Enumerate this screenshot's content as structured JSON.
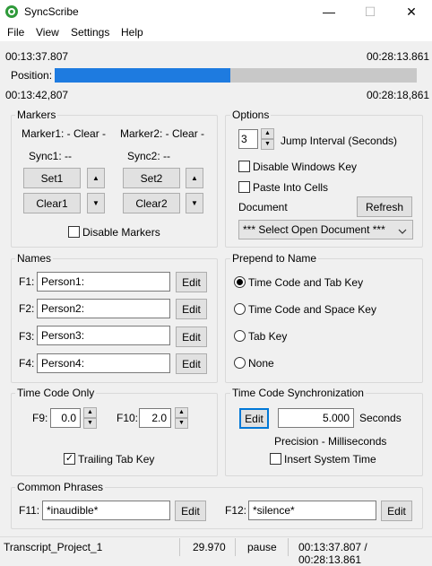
{
  "window": {
    "title": "SyncScribe",
    "minimize_glyph": "—",
    "maximize_glyph": "☐",
    "close_glyph": "✕"
  },
  "menu": [
    "File",
    "View",
    "Settings",
    "Help"
  ],
  "player": {
    "current_time_top": "00:13:37.807",
    "total_time_top": "00:28:13.861",
    "position_label": "Position:",
    "progress_fraction": 0.485,
    "current_time_bottom": "00:13:42,807",
    "total_time_bottom": "00:28:18,861"
  },
  "markers": {
    "title": "Markers",
    "marker1_label": "Marker1: - Clear -",
    "marker2_label": "Marker2: - Clear -",
    "sync1_label": "Sync1: --",
    "sync2_label": "Sync2: --",
    "set1_label": "Set1",
    "set2_label": "Set2",
    "clear1_label": "Clear1",
    "clear2_label": "Clear2",
    "disable_label": "Disable Markers",
    "disable_checked": false
  },
  "options": {
    "title": "Options",
    "jump_interval_value": "3",
    "jump_interval_label": "Jump Interval (Seconds)",
    "disable_windows_key_label": "Disable Windows Key",
    "paste_into_cells_label": "Paste Into Cells",
    "document_label": "Document",
    "refresh_label": "Refresh",
    "document_select": "*** Select Open Document ***"
  },
  "names": {
    "title": "Names",
    "edit_label": "Edit",
    "rows": [
      {
        "key": "F1:",
        "value": "Person1:"
      },
      {
        "key": "F2:",
        "value": "Person2:"
      },
      {
        "key": "F3:",
        "value": "Person3:"
      },
      {
        "key": "F4:",
        "value": "Person4:"
      }
    ]
  },
  "prepend": {
    "title": "Prepend to Name",
    "selected_index": 0,
    "options": [
      "Time Code and Tab Key",
      "Time Code and Space Key",
      "Tab Key",
      "None"
    ]
  },
  "timecode_only": {
    "title": "Time Code Only",
    "f9_label": "F9:",
    "f9_value": "0.0",
    "f10_label": "F10:",
    "f10_value": "2.0",
    "trailing_tab_label": "Trailing Tab Key",
    "trailing_tab_checked": true
  },
  "tc_sync": {
    "title": "Time Code Synchronization",
    "edit_label": "Edit",
    "value": "5.000",
    "unit": "Seconds",
    "precision_label": "Precision - Milliseconds",
    "insert_system_time_label": "Insert System Time"
  },
  "phrases": {
    "title": "Common Phrases",
    "f11_label": "F11:",
    "f11_value": "*inaudible*",
    "f12_label": "F12:",
    "f12_value": "*silence*",
    "edit_label": "Edit"
  },
  "status": {
    "project": "Transcript_Project_1",
    "fps": "29.970",
    "state": "pause",
    "timecode": "00:13:37.807 / 00:28:13.861"
  },
  "icons": {
    "app": "app-logo-icon",
    "up": "▲",
    "down": "▼",
    "check": "✓",
    "dropdown": "chevron-down-icon"
  }
}
